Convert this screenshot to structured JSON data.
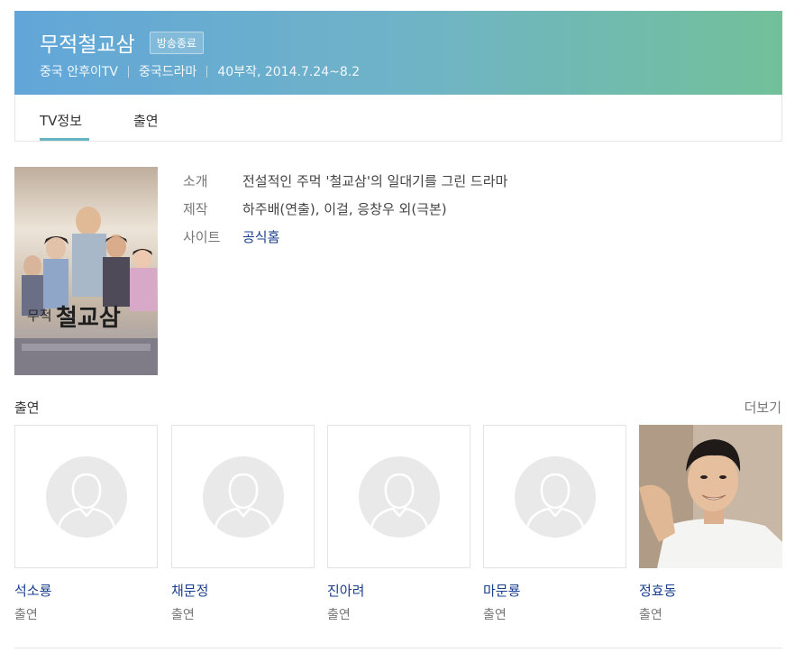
{
  "header": {
    "title": "무적철교삼",
    "badge": "방송종료",
    "meta": [
      "중국 안후이TV",
      "중국드라마",
      "40부작, 2014.7.24~8.2"
    ],
    "gradient_start": "#62a6d9",
    "gradient_end": "#72c09a"
  },
  "tabs": [
    {
      "label": "TV정보",
      "active": true
    },
    {
      "label": "출연",
      "active": false
    }
  ],
  "poster": {
    "title_text": "무적 철교삼"
  },
  "info": [
    {
      "label": "소개",
      "value": "전설적인 주먹 '철교삼'의 일대기를 그린 드라마"
    },
    {
      "label": "제작",
      "value": "하주배(연출), 이걸, 응창우 외(극본)"
    },
    {
      "label": "사이트",
      "value": "공식홈"
    }
  ],
  "cast_section": {
    "title": "출연",
    "more": "더보기",
    "members": [
      {
        "name": "석소룡",
        "role": "출연",
        "has_photo": false
      },
      {
        "name": "채문정",
        "role": "출연",
        "has_photo": false
      },
      {
        "name": "진아려",
        "role": "출연",
        "has_photo": false
      },
      {
        "name": "마문룡",
        "role": "출연",
        "has_photo": false
      },
      {
        "name": "정효동",
        "role": "출연",
        "has_photo": true
      }
    ]
  },
  "colors": {
    "accent": "#66b5c3",
    "link": "#1a3f8f",
    "label": "#777777"
  }
}
